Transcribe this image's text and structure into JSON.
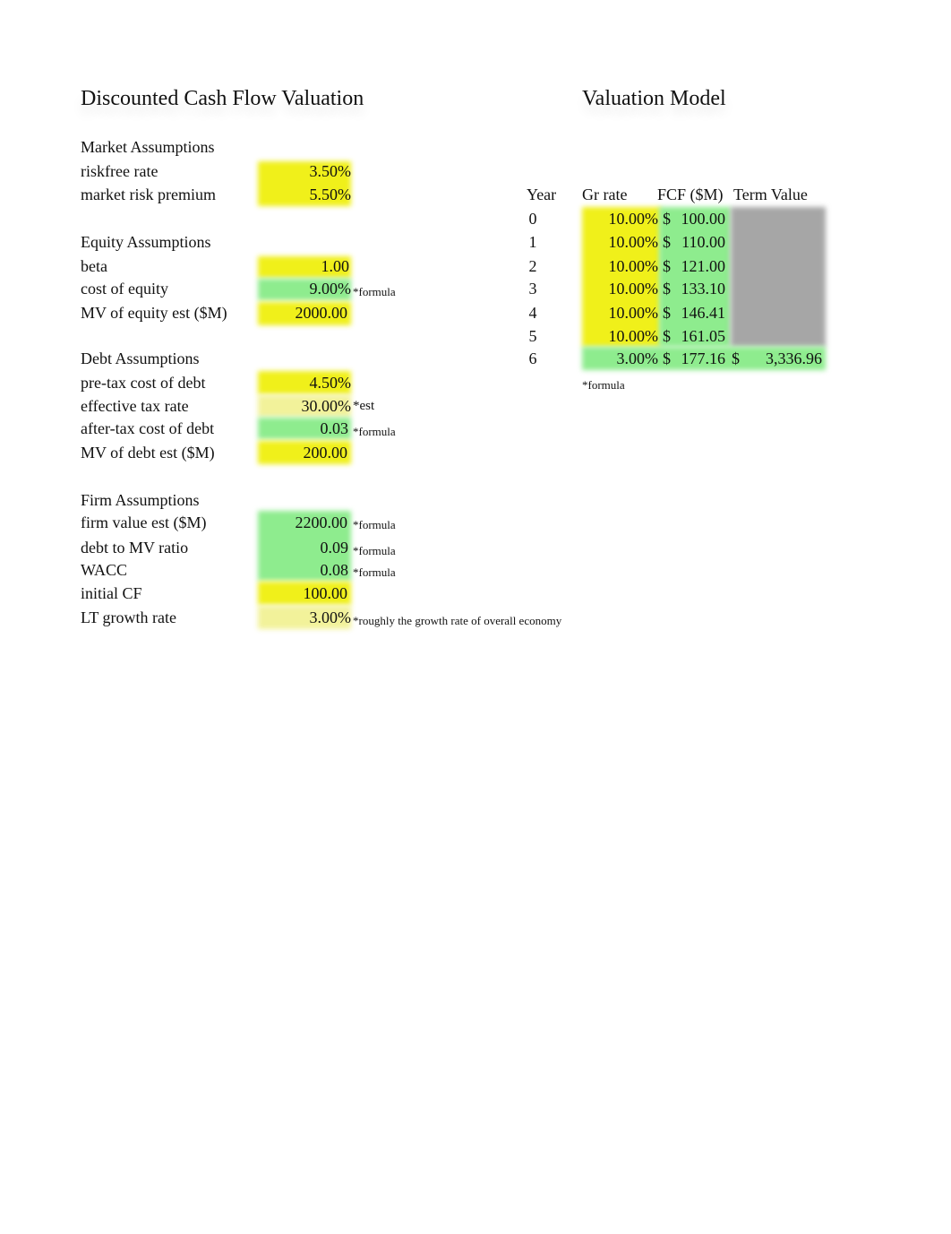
{
  "colors": {
    "input": "#f0f01a",
    "estimate": "#f2f29a",
    "formula": "#8eec8e",
    "blank": "#a6a6a6"
  },
  "left": {
    "title": "Discounted Cash Flow Valuation",
    "market": {
      "heading": "Market Assumptions",
      "rows": [
        {
          "label": "riskfree rate",
          "value": "3.50%",
          "note": ""
        },
        {
          "label": "market risk premium",
          "value": "5.50%",
          "note": ""
        }
      ]
    },
    "equity": {
      "heading": "Equity Assumptions",
      "rows": [
        {
          "label": "beta",
          "value": "1.00",
          "note": ""
        },
        {
          "label": "cost of equity",
          "value": "9.00%",
          "note": "*formula"
        },
        {
          "label": "MV of equity est ($M)",
          "value": "2000.00",
          "note": ""
        }
      ]
    },
    "debt": {
      "heading": "Debt Assumptions",
      "rows": [
        {
          "label": "pre-tax cost of debt",
          "value": "4.50%",
          "note": ""
        },
        {
          "label": "effective tax rate",
          "value": "30.00%",
          "note": "*est"
        },
        {
          "label": "after-tax cost of debt",
          "value": "0.03",
          "note": "*formula"
        },
        {
          "label": "MV of debt est ($M)",
          "value": "200.00",
          "note": ""
        }
      ]
    },
    "firm": {
      "heading": "Firm Assumptions",
      "rows": [
        {
          "label": "firm value est ($M)",
          "value": "2200.00",
          "note": "*formula"
        },
        {
          "label": "debt to MV ratio",
          "value": "0.09",
          "note": "*formula"
        },
        {
          "label": "WACC",
          "value": "0.08",
          "note": "*formula"
        },
        {
          "label": "initial CF",
          "value": "100.00",
          "note": ""
        },
        {
          "label": "LT growth rate",
          "value": "3.00%",
          "note": "*roughly the growth rate of overall economy"
        }
      ]
    }
  },
  "right": {
    "title": "Valuation Model",
    "headers": {
      "year": "Year",
      "gr": "Gr rate",
      "fcf": "FCF ($M)",
      "tv": "Term Value"
    },
    "currency": "$",
    "rows": [
      {
        "year": "0",
        "gr": "10.00%",
        "fcf": "100.00",
        "tv": ""
      },
      {
        "year": "1",
        "gr": "10.00%",
        "fcf": "110.00",
        "tv": ""
      },
      {
        "year": "2",
        "gr": "10.00%",
        "fcf": "121.00",
        "tv": ""
      },
      {
        "year": "3",
        "gr": "10.00%",
        "fcf": "133.10",
        "tv": ""
      },
      {
        "year": "4",
        "gr": "10.00%",
        "fcf": "146.41",
        "tv": ""
      },
      {
        "year": "5",
        "gr": "10.00%",
        "fcf": "161.05",
        "tv": ""
      },
      {
        "year": "6",
        "gr": "3.00%",
        "fcf": "177.16",
        "tv": "3,336.96"
      }
    ],
    "footnote": "*formula"
  }
}
